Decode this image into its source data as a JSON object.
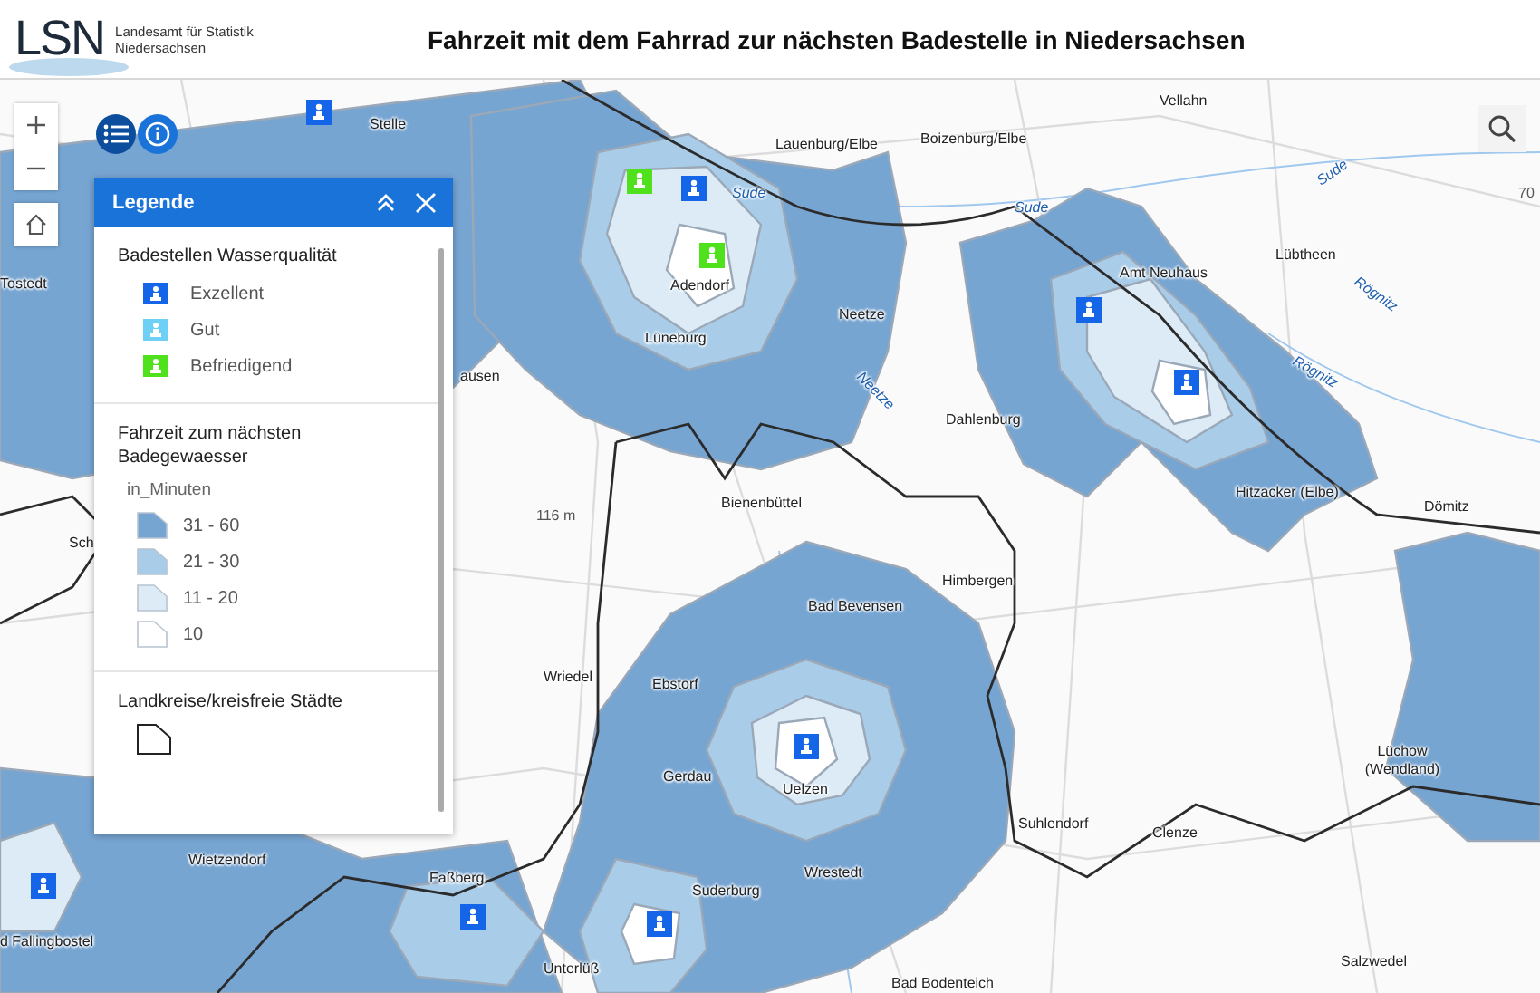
{
  "header": {
    "logo": "LSN",
    "agency_line_1": "Landesamt für Statistik",
    "agency_line_2": "Niedersachsen",
    "title": "Fahrzeit mit dem Fahrrad zur nächsten Badestelle in Niedersachsen"
  },
  "map": {
    "places": [
      {
        "name": "Stelle",
        "kind": "town"
      },
      {
        "name": "Tostedt",
        "kind": "town"
      },
      {
        "name": "Lauenburg/Elbe",
        "kind": "town"
      },
      {
        "name": "Boizenburg/Elbe",
        "kind": "town"
      },
      {
        "name": "Vellahn",
        "kind": "town"
      },
      {
        "name": "Adendorf",
        "kind": "town"
      },
      {
        "name": "Lüneburg",
        "kind": "town"
      },
      {
        "name": "Neetze",
        "kind": "town"
      },
      {
        "name": "Amt Neuhaus",
        "kind": "town"
      },
      {
        "name": "Lübtheen",
        "kind": "town"
      },
      {
        "name": "Dahlenburg",
        "kind": "town"
      },
      {
        "name": "Hitzacker (Elbe)",
        "kind": "town"
      },
      {
        "name": "Dömitz",
        "kind": "town"
      },
      {
        "name": "ausen",
        "kind": "town"
      },
      {
        "name": "Bienenbüttel",
        "kind": "town"
      },
      {
        "name": "116 m",
        "kind": "elevation"
      },
      {
        "name": "70",
        "kind": "elevation"
      },
      {
        "name": "Sch",
        "kind": "town"
      },
      {
        "name": "Himbergen",
        "kind": "town"
      },
      {
        "name": "Bad Bevensen",
        "kind": "town"
      },
      {
        "name": "Wriedel",
        "kind": "town"
      },
      {
        "name": "Ebstorf",
        "kind": "town"
      },
      {
        "name": "Gerdau",
        "kind": "town"
      },
      {
        "name": "Uelzen",
        "kind": "town"
      },
      {
        "name": "Suhlendorf",
        "kind": "town"
      },
      {
        "name": "Lüchow (Wendland)",
        "kind": "town"
      },
      {
        "name": "Clenze",
        "kind": "town"
      },
      {
        "name": "Wrestedt",
        "kind": "town"
      },
      {
        "name": "Suderburg",
        "kind": "town"
      },
      {
        "name": "Faßberg",
        "kind": "town"
      },
      {
        "name": "Wietzendorf",
        "kind": "town"
      },
      {
        "name": "d Fallingbostel",
        "kind": "town"
      },
      {
        "name": "Unterlüß",
        "kind": "town"
      },
      {
        "name": "Bad Bodenteich",
        "kind": "town"
      },
      {
        "name": "Salzwedel",
        "kind": "town"
      },
      {
        "name": "Sude",
        "kind": "river"
      },
      {
        "name": "Sude",
        "kind": "river"
      },
      {
        "name": "Sude",
        "kind": "river"
      },
      {
        "name": "Rögnitz",
        "kind": "river"
      },
      {
        "name": "Neetze",
        "kind": "river"
      },
      {
        "name": "Rögnitz",
        "kind": "river"
      }
    ],
    "sites": [
      {
        "color": "#1565e8"
      },
      {
        "color": "#4fe21c"
      },
      {
        "color": "#1565e8"
      },
      {
        "color": "#4fe21c"
      },
      {
        "color": "#1565e8"
      },
      {
        "color": "#1565e8"
      },
      {
        "color": "#1565e8"
      },
      {
        "color": "#1565e8"
      },
      {
        "color": "#1565e8"
      },
      {
        "color": "#1565e8"
      }
    ]
  },
  "legend": {
    "title": "Legende",
    "sections": [
      {
        "title": "Badestellen Wasserqualität",
        "items": [
          {
            "kind": "site",
            "label": "Exzellent",
            "color": "#1565e8"
          },
          {
            "kind": "site",
            "label": "Gut",
            "color": "#6fd0f5"
          },
          {
            "kind": "site",
            "label": "Befriedigend",
            "color": "#4fe21c"
          }
        ]
      },
      {
        "title": "Fahrzeit zum nächsten Badegewaesser",
        "subtitle": "in_Minuten",
        "items": [
          {
            "kind": "area",
            "label": "31 - 60",
            "color": "#77a5d2"
          },
          {
            "kind": "area",
            "label": "21 - 30",
            "color": "#a9cde9"
          },
          {
            "kind": "area",
            "label": "11 - 20",
            "color": "#dcebf6"
          },
          {
            "kind": "area",
            "label": "10",
            "color": "#ffffff"
          }
        ]
      },
      {
        "title": "Landkreise/kreisfreie Städte",
        "items": [
          {
            "kind": "boundary"
          }
        ]
      }
    ]
  }
}
